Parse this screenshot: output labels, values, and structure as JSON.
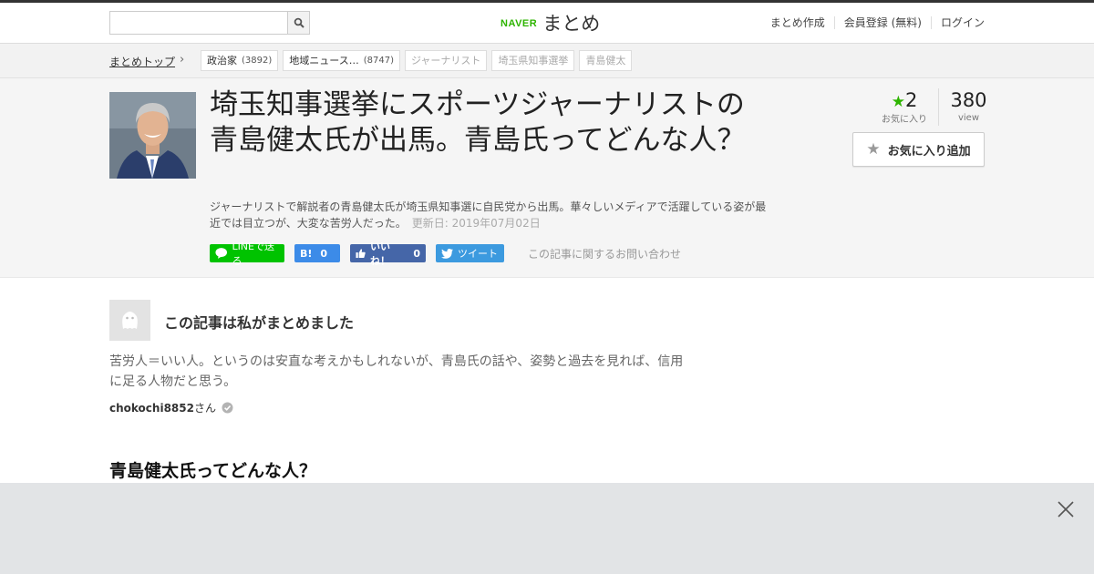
{
  "header": {
    "search": {
      "value": "",
      "placeholder": ""
    },
    "logo": {
      "naver": "NAVER",
      "matome": "まとめ"
    },
    "nav": [
      "まとめ作成",
      "会員登録 (無料)",
      "ログイン"
    ]
  },
  "breadcrumb": {
    "home": "まとめトップ",
    "tags": [
      {
        "label": "政治家",
        "count": "(3892)"
      },
      {
        "label": "地域ニュース…",
        "count": "(8747)"
      },
      {
        "label": "ジャーナリスト",
        "count": ""
      },
      {
        "label": "埼玉県知事選挙",
        "count": ""
      },
      {
        "label": "青島健太",
        "count": ""
      }
    ]
  },
  "article": {
    "title": "埼玉知事選挙にスポーツジャーナリストの青島健太氏が出馬。青島氏ってどんな人？",
    "description": "ジャーナリストで解説者の青島健太氏が埼玉県知事選に自民党から出馬。華々しいメディアで活躍している姿が最近では目立つが、大変な苦労人だった。",
    "updated": "更新日: 2019年07月02日",
    "share": {
      "line": "LINEで送る",
      "hatena_mark": "B!",
      "hatena_count": "0",
      "like_label": "いいね！",
      "like_count": "0",
      "tweet": "ツイート"
    },
    "inquiry": "この記事に関するお問い合わせ",
    "stats": {
      "favorites": "2",
      "favorites_label": "お気に入り",
      "views": "380",
      "views_label": "view"
    },
    "fav_button": "お気に入り追加"
  },
  "curator": {
    "heading": "この記事は私がまとめました",
    "text": "苦労人＝いい人。というのは安直な考えかもしれないが、青島氏の話や、姿勢と過去を見れば、信用に足る人物だと思う。",
    "username": "chokochi8852",
    "suffix": "さん"
  },
  "section": {
    "heading": "青島健太氏ってどんな人？"
  },
  "colors": {
    "brand_green": "#2db400",
    "line_green": "#00c300",
    "hatena_blue": "#3c8be8",
    "facebook_blue": "#4566a8",
    "twitter_blue": "#3c9adf"
  }
}
